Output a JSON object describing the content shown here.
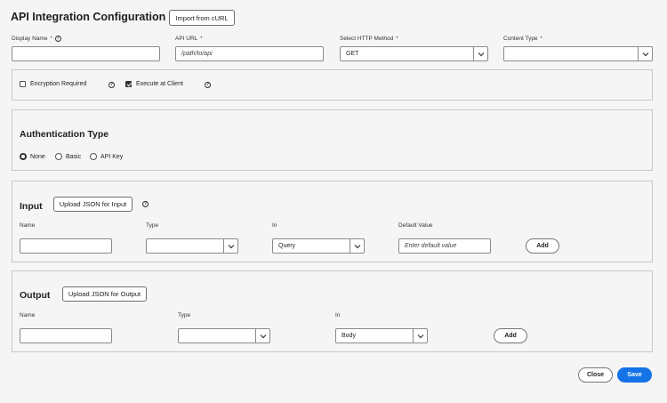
{
  "header": {
    "title": "API Integration Configuration",
    "import_button": "Import from cURL"
  },
  "fields": {
    "display_name": {
      "label": "Display Name",
      "required": "*",
      "value": ""
    },
    "api_url": {
      "label": "API URL",
      "required": "*",
      "value": "/path/to/api"
    },
    "http_method": {
      "label": "Select HTTP Method",
      "required": "*",
      "value": "GET"
    },
    "content_type": {
      "label": "Content Type",
      "required": "*",
      "value": ""
    }
  },
  "options": {
    "encryption": {
      "label": "Encryption Required",
      "checked": false
    },
    "execute_client": {
      "label": "Execute at Client",
      "checked": true
    }
  },
  "auth": {
    "title": "Authentication Type",
    "options": [
      {
        "label": "None",
        "selected": true
      },
      {
        "label": "Basic",
        "selected": false
      },
      {
        "label": "API Key",
        "selected": false
      }
    ]
  },
  "input": {
    "title": "Input",
    "upload_button": "Upload JSON for Input",
    "columns": {
      "name": "Name",
      "type": "Type",
      "in": "In",
      "default": "Default Value"
    },
    "row": {
      "name": "",
      "type": "",
      "in": "Query",
      "default_placeholder": "Enter default value"
    },
    "add_button": "Add"
  },
  "output": {
    "title": "Output",
    "upload_button": "Upload JSON for Output",
    "columns": {
      "name": "Name",
      "type": "Type",
      "in": "In"
    },
    "row": {
      "name": "",
      "type": "",
      "in": "Body"
    },
    "add_button": "Add"
  },
  "footer": {
    "close": "Close",
    "save": "Save"
  },
  "icons": {
    "help": "help-icon",
    "chevron": "chevron-down-icon"
  },
  "colors": {
    "primary": "#1473e6"
  }
}
